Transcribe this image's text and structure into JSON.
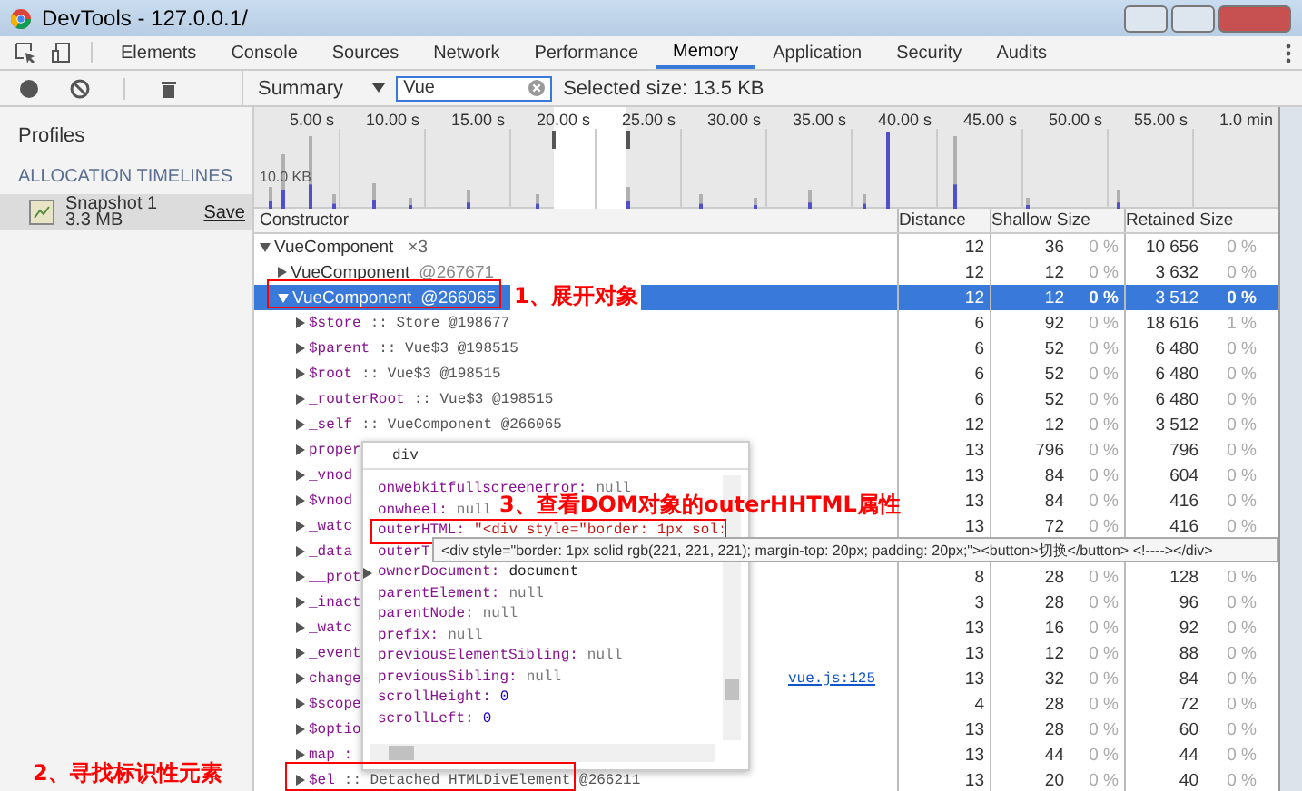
{
  "window": {
    "title": "DevTools - 127.0.0.1/"
  },
  "tabs": [
    {
      "label": "Elements",
      "selected": false
    },
    {
      "label": "Console",
      "selected": false
    },
    {
      "label": "Sources",
      "selected": false
    },
    {
      "label": "Network",
      "selected": false
    },
    {
      "label": "Performance",
      "selected": false
    },
    {
      "label": "Memory",
      "selected": true
    },
    {
      "label": "Application",
      "selected": false
    },
    {
      "label": "Security",
      "selected": false
    },
    {
      "label": "Audits",
      "selected": false
    }
  ],
  "toolbar": {
    "view": "Summary",
    "filter": "Vue",
    "selected_size": "Selected size: 13.5 KB"
  },
  "sidebar": {
    "heading": "Profiles",
    "section": "ALLOCATION TIMELINES",
    "items": [
      {
        "name": "Snapshot 1",
        "size": "3.3 MB",
        "action": "Save",
        "selected": true
      }
    ]
  },
  "timeline": {
    "ticks": [
      "5.00 s",
      "10.00 s",
      "15.00 s",
      "20.00 s",
      "25.00 s",
      "30.00 s",
      "35.00 s",
      "40.00 s",
      "45.00 s",
      "50.00 s",
      "55.00 s",
      "1.0 min"
    ],
    "scale_label": "10.0 KB"
  },
  "table": {
    "columns": [
      "Constructor",
      "Distance",
      "Shallow Size",
      "Retained Size"
    ],
    "rows": [
      {
        "kind": "group",
        "name": "VueComponent",
        "value": "×3",
        "distance": "12",
        "shallow": "36",
        "shallow_pct": "0 %",
        "retained": "10 656",
        "retained_pct": "0 %",
        "expanded": true,
        "selected": false,
        "children": [
          {
            "kind": "object",
            "name": "VueComponent",
            "value": "@267671",
            "distance": "12",
            "shallow": "12",
            "shallow_pct": "0 %",
            "retained": "3 632",
            "retained_pct": "0 %",
            "expanded": false,
            "selected": false
          },
          {
            "kind": "object",
            "name": "VueComponent",
            "value": "@266065",
            "distance": "12",
            "shallow": "12",
            "shallow_pct": "0 %",
            "retained": "3 512",
            "retained_pct": "0 %",
            "expanded": true,
            "selected": true,
            "children": [
              {
                "kind": "property",
                "name": "$store",
                "value": ":: Store @198677",
                "distance": "6",
                "shallow": "92",
                "shallow_pct": "0 %",
                "retained": "18 616",
                "retained_pct": "1 %",
                "expanded": false,
                "selected": false
              },
              {
                "kind": "property",
                "name": "$parent",
                "value": ":: Vue$3 @198515",
                "distance": "6",
                "shallow": "52",
                "shallow_pct": "0 %",
                "retained": "6 480",
                "retained_pct": "0 %",
                "expanded": false,
                "selected": false
              },
              {
                "kind": "property",
                "name": "$root",
                "value": ":: Vue$3 @198515",
                "distance": "6",
                "shallow": "52",
                "shallow_pct": "0 %",
                "retained": "6 480",
                "retained_pct": "0 %",
                "expanded": false,
                "selected": false
              },
              {
                "kind": "property",
                "name": "_routerRoot",
                "value": ":: Vue$3 @198515",
                "distance": "6",
                "shallow": "52",
                "shallow_pct": "0 %",
                "retained": "6 480",
                "retained_pct": "0 %",
                "expanded": false,
                "selected": false
              },
              {
                "kind": "property",
                "name": "_self",
                "value": ":: VueComponent @266065",
                "distance": "12",
                "shallow": "12",
                "shallow_pct": "0 %",
                "retained": "3 512",
                "retained_pct": "0 %",
                "expanded": false,
                "selected": false
              },
              {
                "kind": "property",
                "name": "proper",
                "distance": "13",
                "shallow": "796",
                "shallow_pct": "0 %",
                "retained": "796",
                "retained_pct": "0 %",
                "expanded": false,
                "selected": false
              },
              {
                "kind": "property",
                "name": "_vnod",
                "distance": "13",
                "shallow": "84",
                "shallow_pct": "0 %",
                "retained": "604",
                "retained_pct": "0 %",
                "expanded": false,
                "selected": false
              },
              {
                "kind": "property",
                "name": "$vnod",
                "distance": "13",
                "shallow": "84",
                "shallow_pct": "0 %",
                "retained": "416",
                "retained_pct": "0 %",
                "expanded": false,
                "selected": false
              },
              {
                "kind": "property",
                "name": "_watc",
                "distance": "13",
                "shallow": "72",
                "shallow_pct": "0 %",
                "retained": "416",
                "retained_pct": "0 %",
                "expanded": false,
                "selected": false
              },
              {
                "kind": "property",
                "name": "_data",
                "expanded": false,
                "selected": false,
                "tooltip": "<div style=\"border: 1px solid rgb(221, 221, 221); margin-top: 20px; padding: 20px;\"><button>切换</button> <!----></div>"
              },
              {
                "kind": "property",
                "name": "__prot",
                "distance": "8",
                "shallow": "28",
                "shallow_pct": "0 %",
                "retained": "128",
                "retained_pct": "0 %",
                "expanded": false,
                "selected": false
              },
              {
                "kind": "property",
                "name": "_inact",
                "distance": "3",
                "shallow": "28",
                "shallow_pct": "0 %",
                "retained": "96",
                "retained_pct": "0 %",
                "expanded": false,
                "selected": false
              },
              {
                "kind": "property",
                "name": "_watc",
                "distance": "13",
                "shallow": "16",
                "shallow_pct": "0 %",
                "retained": "92",
                "retained_pct": "0 %",
                "expanded": false,
                "selected": false
              },
              {
                "kind": "property",
                "name": "_event",
                "distance": "13",
                "shallow": "12",
                "shallow_pct": "0 %",
                "retained": "88",
                "retained_pct": "0 %",
                "expanded": false,
                "selected": false
              },
              {
                "kind": "property",
                "name": "change",
                "link": "vue.js:125",
                "distance": "13",
                "shallow": "32",
                "shallow_pct": "0 %",
                "retained": "84",
                "retained_pct": "0 %",
                "expanded": false,
                "selected": false
              },
              {
                "kind": "property",
                "name": "$scope",
                "distance": "4",
                "shallow": "28",
                "shallow_pct": "0 %",
                "retained": "72",
                "retained_pct": "0 %",
                "expanded": false,
                "selected": false
              },
              {
                "kind": "property",
                "name": "$optio",
                "distance": "13",
                "shallow": "28",
                "shallow_pct": "0 %",
                "retained": "60",
                "retained_pct": "0 %",
                "expanded": false,
                "selected": false
              },
              {
                "kind": "property",
                "name": "map :",
                "distance": "13",
                "shallow": "44",
                "shallow_pct": "0 %",
                "retained": "44",
                "retained_pct": "0 %",
                "expanded": false,
                "selected": false
              },
              {
                "kind": "property",
                "name": "$el",
                "value": ":: Detached HTMLDivElement @266211",
                "distance": "13",
                "shallow": "20",
                "shallow_pct": "0 %",
                "retained": "40",
                "retained_pct": "0 %",
                "expanded": false,
                "selected": false
              }
            ]
          }
        ]
      }
    ]
  },
  "popover": {
    "title": "div",
    "entries": [
      {
        "name": "onwebkitfullscreenerror:",
        "value": "null",
        "kind": "null",
        "expandable": false
      },
      {
        "name": "onwheel:",
        "value": "null",
        "kind": "null",
        "expandable": false
      },
      {
        "name": "outerHTML:",
        "value": "\"<div style=\"border: 1px sol:",
        "kind": "string",
        "expandable": false
      },
      {
        "name": "outerT",
        "kind": "string",
        "expandable": false
      },
      {
        "name": "ownerDocument:",
        "value": "document",
        "kind": "object",
        "expandable": true
      },
      {
        "name": "parentElement:",
        "value": "null",
        "kind": "null",
        "expandable": false
      },
      {
        "name": "parentNode:",
        "value": "null",
        "kind": "null",
        "expandable": false
      },
      {
        "name": "prefix:",
        "value": "null",
        "kind": "null",
        "expandable": false
      },
      {
        "name": "previousElementSibling:",
        "value": "null",
        "kind": "null",
        "expandable": false
      },
      {
        "name": "previousSibling:",
        "value": "null",
        "kind": "null",
        "expandable": false
      },
      {
        "name": "scrollHeight:",
        "value": "0",
        "kind": "number",
        "expandable": false
      },
      {
        "name": "scrollLeft:",
        "value": "0",
        "kind": "number",
        "expandable": false
      }
    ]
  },
  "annotations": [
    "1、展开对象",
    "2、寻找标识性元素",
    "3、查看DOM对象的outerHHTML属性"
  ]
}
